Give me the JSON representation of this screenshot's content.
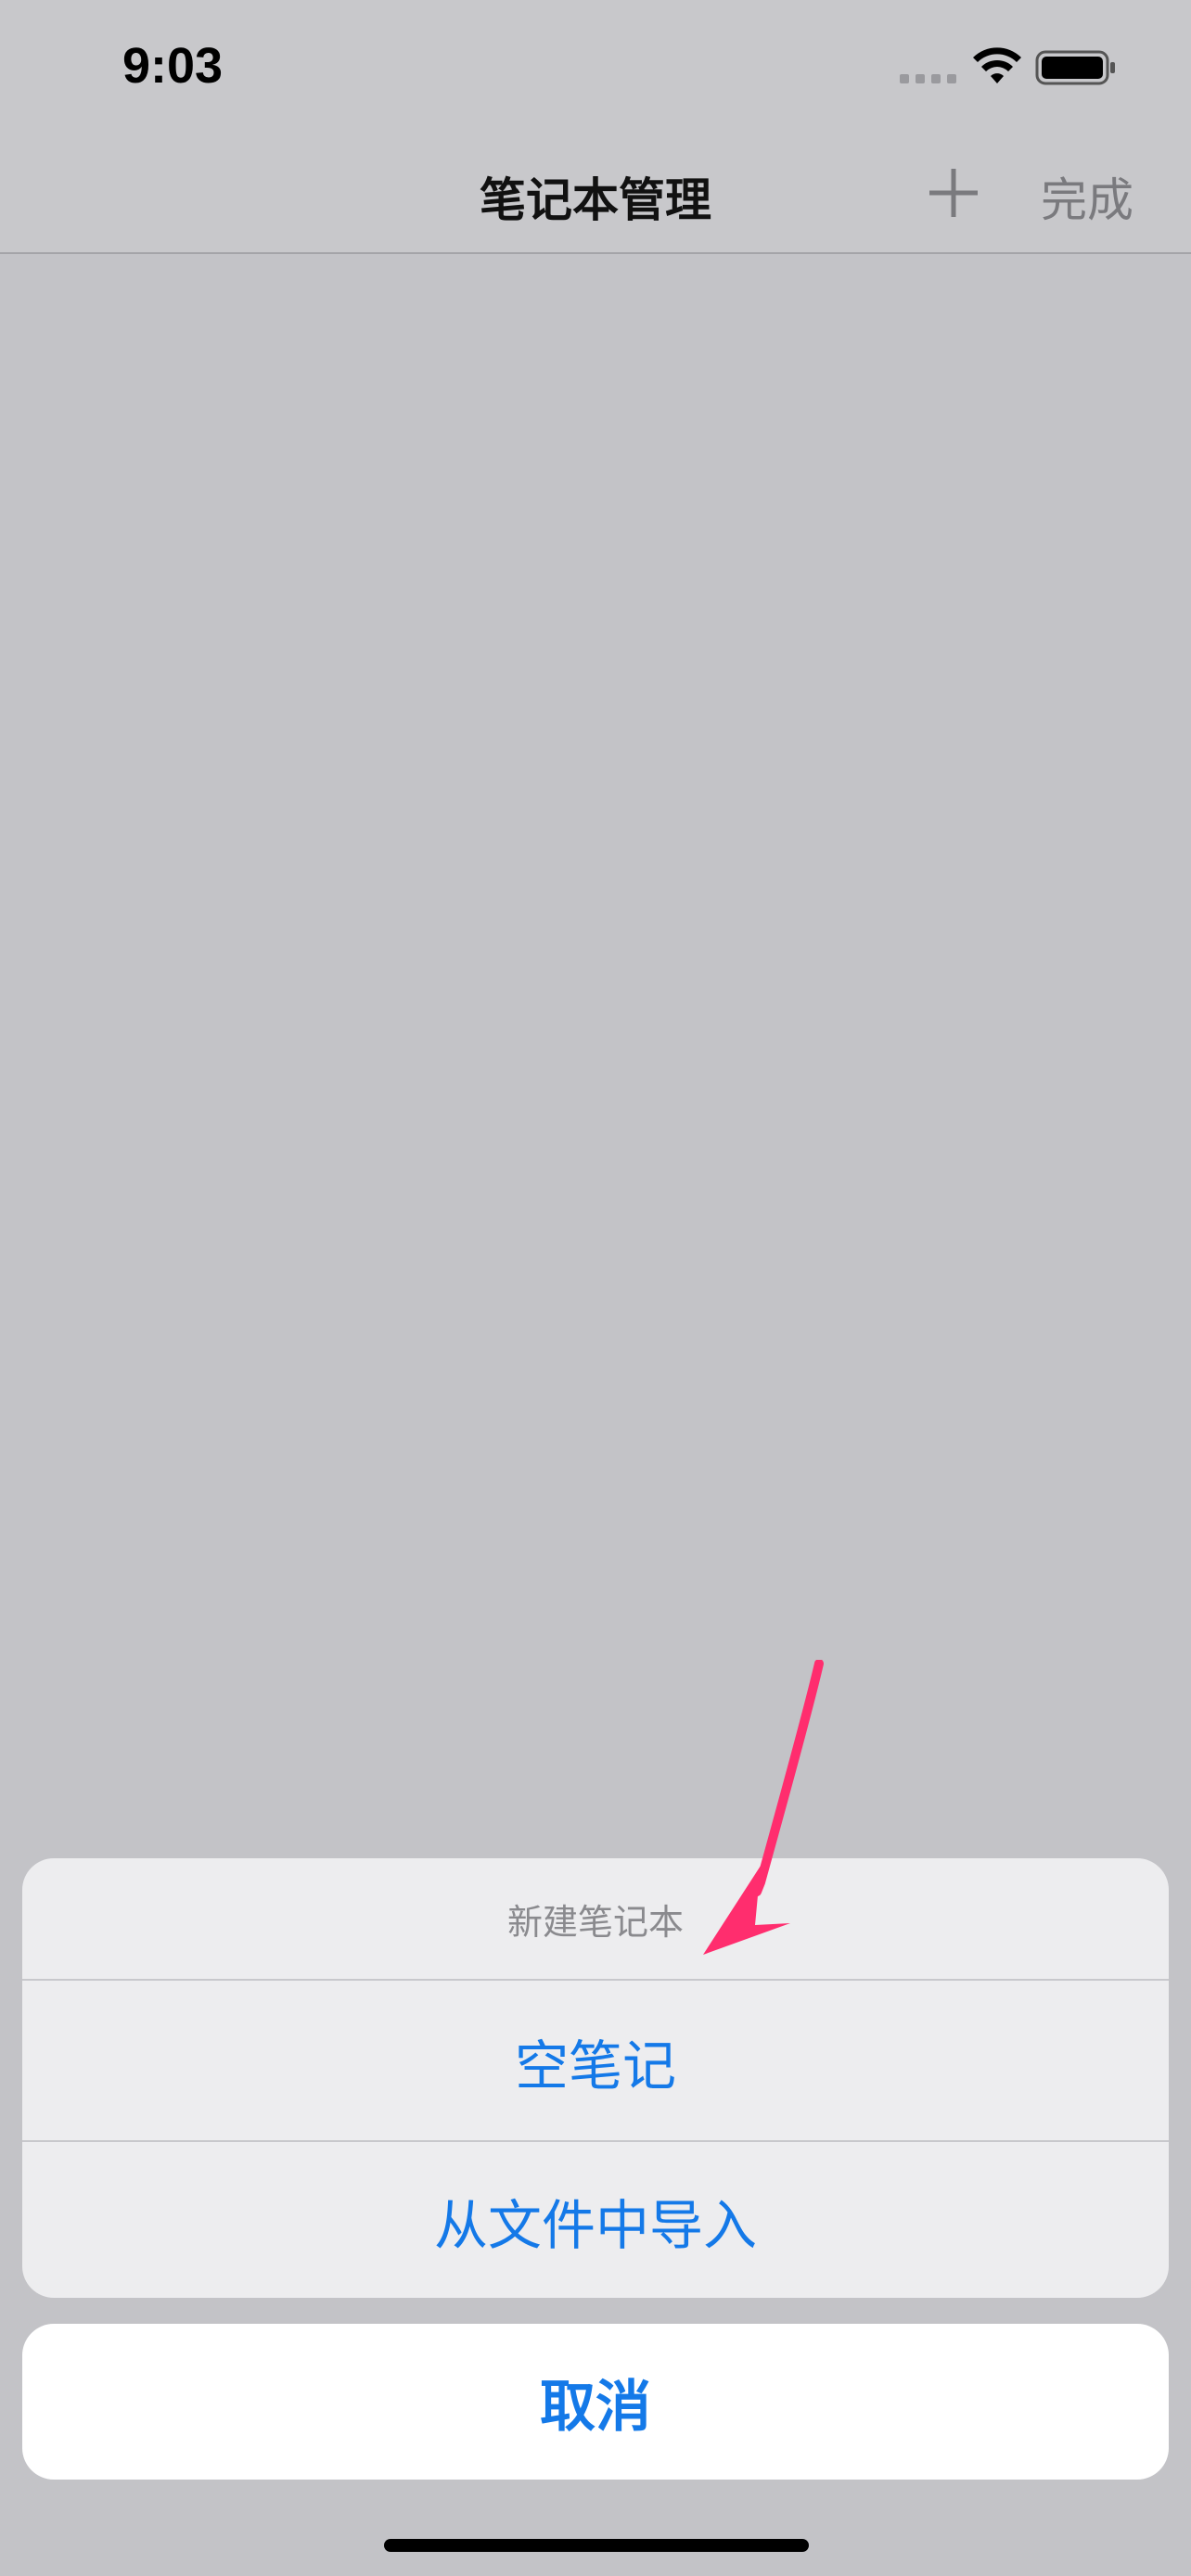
{
  "status_bar": {
    "time": "9:03",
    "icons": [
      "signal-icon",
      "wifi-icon",
      "battery-icon"
    ]
  },
  "nav": {
    "title": "笔记本管理",
    "add_icon": "plus-icon",
    "done_label": "完成"
  },
  "action_sheet": {
    "title": "新建笔记本",
    "options": [
      {
        "label": "空笔记"
      },
      {
        "label": "从文件中导入"
      }
    ],
    "cancel_label": "取消"
  },
  "colors": {
    "accent": "#1479e8",
    "annotation_arrow": "#ff2d6e",
    "dim_background": "#c3c3c7"
  }
}
